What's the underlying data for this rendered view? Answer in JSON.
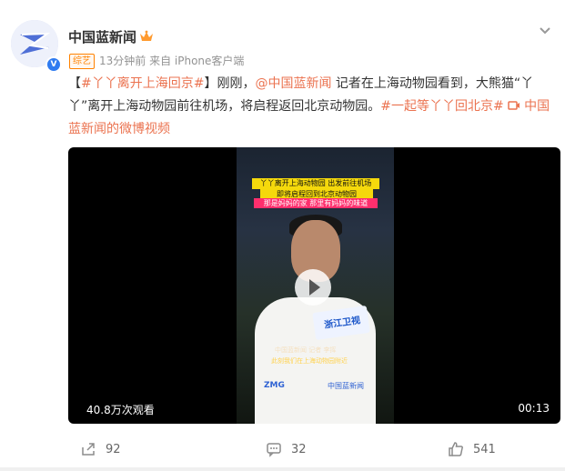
{
  "post": {
    "author": "中国蓝新闻",
    "badge": "V",
    "tag": "综艺",
    "meta": "13分钟前 来自 iPhone客户端",
    "text_parts": {
      "bracket_open": "【",
      "topic1": "#丫丫离开上海回京#",
      "bracket_close": "】刚刚，",
      "mention": "@中国蓝新闻",
      "body": " 记者在上海动物园看到，大熊猫“丫丫”离开上海动物园前往机场，将启程返回北京动物园。",
      "topic2": "#一起等丫丫回北京#",
      "video_link": " 中国蓝新闻的微博视频"
    }
  },
  "video": {
    "caption1": "丫丫离开上海动物园 出发前往机场",
    "caption2": "即将启程回到北京动物园",
    "caption3": "那是妈妈的家 那里有妈妈的味道",
    "mic_label": "浙江卫视",
    "subtitle1": "中国蓝新闻 记者 李挥",
    "subtitle2": "此刻我们在上海动物园附近",
    "logo1": "ZMG",
    "logo2": "中国蓝新闻",
    "views": "40.8万次观看",
    "duration": "00:13"
  },
  "actions": {
    "share": "92",
    "comment": "32",
    "like": "541"
  },
  "colors": {
    "link": "#eb7350",
    "tag": "#ff8200"
  }
}
